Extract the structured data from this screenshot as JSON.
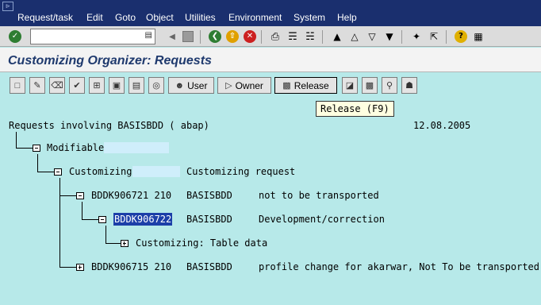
{
  "menu": [
    "Request/task",
    "Edit",
    "Goto",
    "Object",
    "Utilities",
    "Environment",
    "System",
    "Help"
  ],
  "command_field": {
    "value": ""
  },
  "title": "Customizing Organizer: Requests",
  "app_toolbar": {
    "user_label": "User",
    "owner_label": "Owner",
    "release_label": "Release"
  },
  "tooltip": "Release (F9)",
  "tree": {
    "header": "Requests involving BASISBDD ( abap)",
    "date": "12.08.2005",
    "modifiable": "Modifiable",
    "customizing": {
      "label": "Customizing",
      "desc": "Customizing request"
    },
    "req1": {
      "id": "BDDK906721 210",
      "owner": "BASISBDD",
      "desc": "not to be transported"
    },
    "task1": {
      "id": "BDDK906722",
      "owner": "BASISBDD",
      "desc": "Development/correction"
    },
    "table_data": "Customizing: Table data",
    "req2": {
      "id": "BDDK906715 210",
      "owner": "BASISBDD",
      "desc": "profile change for akarwar, Not To be transported"
    }
  },
  "colors": {
    "menubar": "#1a2f6e",
    "background": "#b7e9e9",
    "title": "#1f3a6e",
    "selection": "#1c3fa8"
  }
}
